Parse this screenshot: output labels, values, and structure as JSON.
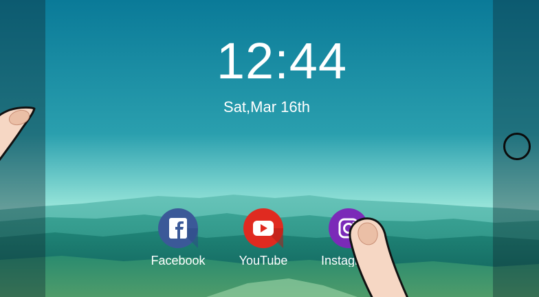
{
  "lockscreen": {
    "time": "12:44",
    "date": "Sat,Mar 16th"
  },
  "apps": [
    {
      "label": "Facebook",
      "icon": "facebook-icon",
      "color": "#3b5998"
    },
    {
      "label": "YouTube",
      "icon": "youtube-icon",
      "color": "#e02a20"
    },
    {
      "label": "Instagram",
      "icon": "instagram-icon",
      "color": "#7b2ab8"
    }
  ],
  "side_controls": {
    "home_button_icon": "circle-home-icon"
  },
  "colors": {
    "sky_top": "#0a7c99",
    "sky_horizon": "#9fe6da",
    "mountain": "#2e9a8e",
    "text": "#ffffff"
  }
}
